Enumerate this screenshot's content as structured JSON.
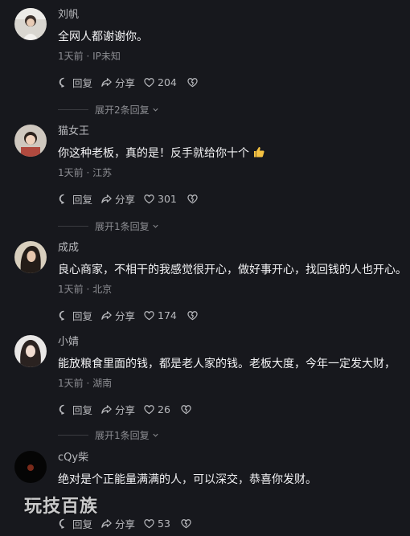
{
  "colors": {
    "background": "#17181d",
    "text": "#f2f2f4",
    "muted": "#8c8d92",
    "username": "#b8b9bd",
    "like_emoji": "#f5c242"
  },
  "labels": {
    "reply": "回复",
    "share": "分享"
  },
  "comments": [
    {
      "username": "刘帆",
      "text": "全网人都谢谢你。",
      "meta": "1天前 · IP未知",
      "likes": "204",
      "expand": "展开2条回复"
    },
    {
      "username": "猫女王",
      "text": "你这种老板，真的是！反手就给你十个",
      "emoji": "thumbs-up-emoji",
      "meta": "1天前 · 江苏",
      "likes": "301",
      "expand": "展开1条回复"
    },
    {
      "username": "成成",
      "text": "良心商家，不相干的我感觉很开心，做好事开心，找回钱的人也开心。",
      "meta": "1天前 · 北京",
      "likes": "174"
    },
    {
      "username": "小婧",
      "text": "能放粮食里面的钱，都是老人家的钱。老板大度，今年一定发大财，",
      "meta": "1天前 · 湖南",
      "likes": "26",
      "expand": "展开1条回复"
    },
    {
      "username": "cQy柴",
      "text": "绝对是个正能量满满的人，可以深交，恭喜你发财。",
      "meta": "",
      "likes": "53"
    }
  ],
  "watermark": "玩技百族"
}
